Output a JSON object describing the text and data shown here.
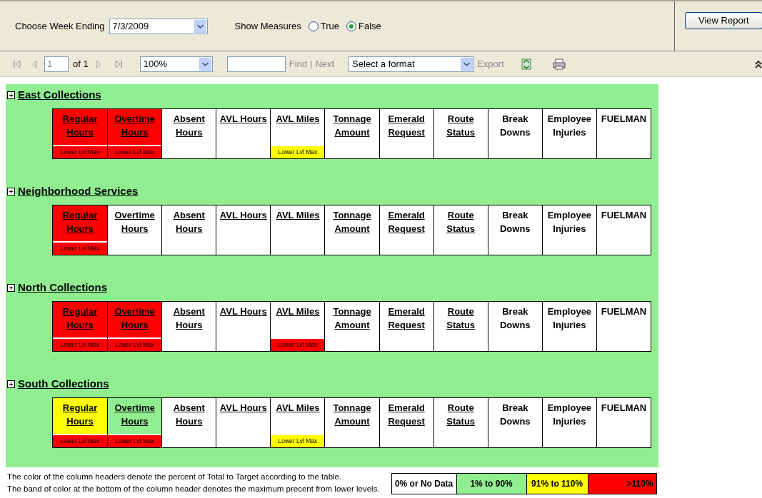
{
  "parameters": {
    "week_label": "Choose Week Ending",
    "week_value": "7/3/2009",
    "measures_label": "Show Measures",
    "measures_options": [
      {
        "label": "True",
        "selected": false
      },
      {
        "label": "False",
        "selected": true
      }
    ],
    "view_button": "View Report"
  },
  "toolbar": {
    "page": "1",
    "page_of": "of 1",
    "zoom": "100%",
    "find": "Find",
    "separator": "|",
    "next": "Next",
    "format": "Select a format",
    "export": "Export"
  },
  "sections": [
    {
      "title": "East Collections",
      "columns": [
        {
          "label": "Regular Hours",
          "link": true,
          "color": "#ff0000",
          "band": {
            "label": "Lower Lvl Max",
            "color": "#ff0000"
          }
        },
        {
          "label": "Overtime Hours",
          "link": true,
          "color": "#ff0000",
          "band": {
            "label": "Lower Lvl Max",
            "color": "#ff0000"
          }
        },
        {
          "label": "Absent Hours",
          "link": true,
          "color": "#ffffff"
        },
        {
          "label": "AVL Hours",
          "link": true,
          "color": "#ffffff"
        },
        {
          "label": "AVL Miles",
          "link": true,
          "color": "#ffffff",
          "band": {
            "label": "Lower Lvl Max",
            "color": "#ffff00"
          }
        },
        {
          "label": "Tonnage Amount",
          "link": true,
          "color": "#ffffff"
        },
        {
          "label": "Emerald Request",
          "link": true,
          "color": "#ffffff"
        },
        {
          "label": "Route Status",
          "link": true,
          "color": "#ffffff"
        },
        {
          "label": "Break Downs",
          "link": false,
          "color": "#ffffff"
        },
        {
          "label": "Employee Injuries",
          "link": false,
          "color": "#ffffff"
        },
        {
          "label": "FUELMAN",
          "link": false,
          "color": "#ffffff"
        }
      ]
    },
    {
      "title": "Neighborhood Services",
      "columns": [
        {
          "label": "Regular Hours",
          "link": true,
          "color": "#ff0000",
          "band": {
            "label": "Lower Lvl Max",
            "color": "#ff0000"
          }
        },
        {
          "label": "Overtime Hours",
          "link": true,
          "color": "#ffffff"
        },
        {
          "label": "Absent Hours",
          "link": true,
          "color": "#ffffff"
        },
        {
          "label": "AVL Hours",
          "link": true,
          "color": "#ffffff"
        },
        {
          "label": "AVL Miles",
          "link": true,
          "color": "#ffffff"
        },
        {
          "label": "Tonnage Amount",
          "link": true,
          "color": "#ffffff"
        },
        {
          "label": "Emerald Request",
          "link": true,
          "color": "#ffffff"
        },
        {
          "label": "Route Status",
          "link": true,
          "color": "#ffffff"
        },
        {
          "label": "Break Downs",
          "link": false,
          "color": "#ffffff"
        },
        {
          "label": "Employee Injuries",
          "link": false,
          "color": "#ffffff"
        },
        {
          "label": "FUELMAN",
          "link": false,
          "color": "#ffffff"
        }
      ]
    },
    {
      "title": "North Collections",
      "columns": [
        {
          "label": "Regular Hours",
          "link": true,
          "color": "#ff0000",
          "band": {
            "label": "Lower Lvl Max",
            "color": "#ff0000"
          }
        },
        {
          "label": "Overtime Hours",
          "link": true,
          "color": "#ff0000",
          "band": {
            "label": "Lower Lvl Max",
            "color": "#ff0000"
          }
        },
        {
          "label": "Absent Hours",
          "link": true,
          "color": "#ffffff"
        },
        {
          "label": "AVL Hours",
          "link": true,
          "color": "#ffffff"
        },
        {
          "label": "AVL Miles",
          "link": true,
          "color": "#ffffff",
          "band": {
            "label": "Lower Lvl Max",
            "color": "#ff0000"
          }
        },
        {
          "label": "Tonnage Amount",
          "link": true,
          "color": "#ffffff"
        },
        {
          "label": "Emerald Request",
          "link": true,
          "color": "#ffffff"
        },
        {
          "label": "Route Status",
          "link": true,
          "color": "#ffffff"
        },
        {
          "label": "Break Downs",
          "link": false,
          "color": "#ffffff"
        },
        {
          "label": "Employee Injuries",
          "link": false,
          "color": "#ffffff"
        },
        {
          "label": "FUELMAN",
          "link": false,
          "color": "#ffffff"
        }
      ]
    },
    {
      "title": "South Collections",
      "columns": [
        {
          "label": "Regular Hours",
          "link": true,
          "color": "#ffff00",
          "band": {
            "label": "Lower Lvl Max",
            "color": "#ff0000"
          }
        },
        {
          "label": "Overtime Hours",
          "link": true,
          "color": "#90ee90",
          "band": {
            "label": "Lower Lvl Max",
            "color": "#ff0000"
          }
        },
        {
          "label": "Absent Hours",
          "link": true,
          "color": "#ffffff"
        },
        {
          "label": "AVL Hours",
          "link": true,
          "color": "#ffffff"
        },
        {
          "label": "AVL Miles",
          "link": true,
          "color": "#ffffff",
          "band": {
            "label": "Lower Lvl Max",
            "color": "#ffff00"
          }
        },
        {
          "label": "Tonnage Amount",
          "link": true,
          "color": "#ffffff"
        },
        {
          "label": "Emerald Request",
          "link": true,
          "color": "#ffffff"
        },
        {
          "label": "Route Status",
          "link": true,
          "color": "#ffffff"
        },
        {
          "label": "Break Downs",
          "link": false,
          "color": "#ffffff"
        },
        {
          "label": "Employee Injuries",
          "link": false,
          "color": "#ffffff"
        },
        {
          "label": "FUELMAN",
          "link": false,
          "color": "#ffffff"
        }
      ]
    }
  ],
  "footer_notes": [
    "The color of the column headers denote the percent of Total to Target according to the table.",
    "The band of color at the bottom of the column header denotes the maximum precent from lower levels."
  ],
  "legend": [
    {
      "label": "0% or No Data",
      "color": "#ffffff"
    },
    {
      "label": "1% to 90%",
      "color": "#90ee90"
    },
    {
      "label": "91% to 110%",
      "color": "#ffff00"
    },
    {
      "label": ">110%",
      "color": "#ff0000"
    }
  ]
}
